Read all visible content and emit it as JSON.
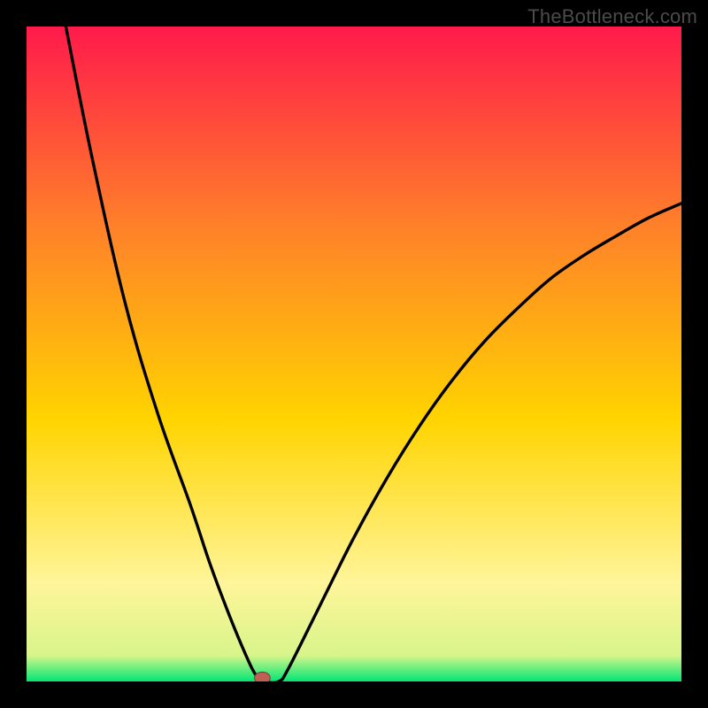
{
  "watermark": "TheBottleneck.com",
  "colors": {
    "background_frame": "#000000",
    "gradient_top": "#ff1a4b",
    "gradient_mid1": "#ff7f2a",
    "gradient_mid2": "#ffd400",
    "gradient_low": "#fff59a",
    "gradient_bottom": "#00e676",
    "curve": "#000000",
    "marker_fill": "#c06055",
    "marker_stroke": "#7a3b33"
  },
  "chart_data": {
    "type": "line",
    "title": "",
    "xlabel": "",
    "ylabel": "",
    "xlim": [
      0,
      100
    ],
    "ylim": [
      0,
      100
    ],
    "grid": false,
    "legend": false,
    "description": "V-shaped bottleneck curve over a red→orange→yellow→green vertical gradient. Minimum (best match) occurs near x≈36 at y≈0. Left branch rises steeply to y≈100 at x≈6; right branch rises to y≈73 at x=100.",
    "optimum_x": 36,
    "series": [
      {
        "name": "bottleneck-curve",
        "x": [
          6,
          10,
          15,
          20,
          25,
          28,
          31,
          33.5,
          35,
          36.5,
          38.5,
          40,
          45,
          50,
          55,
          60,
          65,
          70,
          75,
          80,
          85,
          90,
          95,
          100
        ],
        "y": [
          100,
          80,
          58,
          41,
          27,
          18,
          10,
          4,
          1,
          0,
          0,
          2,
          12,
          22,
          31,
          39,
          46,
          52,
          57,
          61.5,
          65,
          68,
          70.8,
          73
        ]
      }
    ],
    "marker": {
      "x": 36,
      "y": 0,
      "rx": 1.2,
      "ry": 0.9
    }
  }
}
